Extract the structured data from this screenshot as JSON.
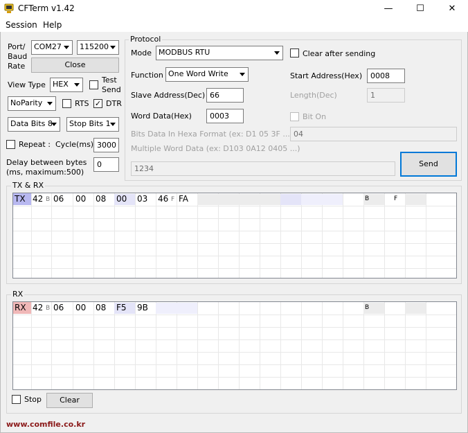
{
  "window": {
    "title": "CFTerm v1.42",
    "minimize": "—",
    "maximize": "☐",
    "close": "✕"
  },
  "menu": [
    "Session",
    "Help"
  ],
  "port": {
    "label_lines": [
      "Port/",
      "Baud",
      "Rate"
    ],
    "port_value": "COM27",
    "baud_value": "115200",
    "close_label": "Close"
  },
  "view": {
    "label": "View Type",
    "value": "HEX",
    "test_send_lines": [
      "Test",
      "Send"
    ]
  },
  "parity": {
    "value": "NoParity",
    "rts_label": "RTS",
    "dtr_label": "DTR"
  },
  "bits": {
    "data_bits": "Data Bits 8",
    "stop_bits": "Stop Bits 1"
  },
  "repeat": {
    "label": "Repeat :",
    "cycle_label": "Cycle(ms)",
    "cycle_value": "3000"
  },
  "delay": {
    "label_lines": [
      "Delay between bytes",
      "(ms, maximum:500)"
    ],
    "value": "0"
  },
  "protocol": {
    "group_title": "Protocol",
    "mode_label": "Mode",
    "mode_value": "MODBUS RTU",
    "clear_after_sending": "Clear after sending",
    "function_label": "Function",
    "function_value": "One Word Write",
    "start_address_label": "Start Address(Hex)",
    "start_address_value": "0008",
    "slave_address_label": "Slave Address(Dec)",
    "slave_address_value": "66",
    "length_label": "Length(Dec)",
    "length_value": "1",
    "word_data_label": "Word Data(Hex)",
    "word_data_value": "0003",
    "bit_on_label": "Bit On",
    "bits_data_label": "Bits Data In Hexa Format (ex: D1 05 3F ...)",
    "bits_data_value": "04",
    "multi_word_label": "Multiple Word Data (ex: D103 0A12 0405 ...)",
    "multi_word_value": "1234",
    "send_label": "Send"
  },
  "txrx": {
    "group_title": "TX & RX",
    "tag": "TX",
    "bytes": [
      "42",
      "06",
      "00",
      "08",
      "00",
      "03",
      "46",
      "FA"
    ],
    "ascii": {
      "b": "B",
      "f": "F",
      "B_right": "B",
      "F_right": "F"
    }
  },
  "rx": {
    "group_title": "RX",
    "tag": "RX",
    "bytes": [
      "42",
      "06",
      "00",
      "08",
      "F5",
      "9B"
    ],
    "ascii": {
      "b": "B",
      "B_right": "B"
    },
    "stop_label": "Stop",
    "clear_label": "Clear"
  },
  "footer": {
    "url": "www.comfile.co.kr"
  },
  "colors": {
    "tx_tag": "#b8b8f0",
    "rx_tag": "#f0b8b8",
    "accent": "#0078d7",
    "footer_text": "#8b1a1a"
  }
}
